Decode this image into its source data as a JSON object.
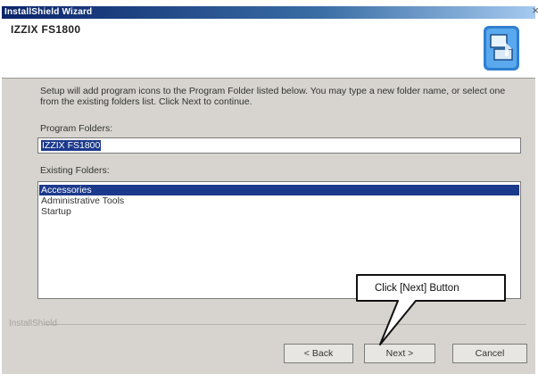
{
  "window": {
    "title": "InstallShield Wizard",
    "close_glyph": "×"
  },
  "header": {
    "product": "IZZIX FS1800",
    "logo_icon": "installshield-computer-icon"
  },
  "instructions": "Setup will add program icons to the Program Folder listed below. You may type a new folder name, or select one from the existing folders list. Click Next to continue.",
  "program_folder": {
    "label": "Program Folders:",
    "value": "IZZIX FS1800"
  },
  "existing_folders": {
    "label": "Existing Folders:",
    "items": [
      "Accessories",
      "Administrative Tools",
      "Startup"
    ],
    "selected_index": 0
  },
  "footer": {
    "brand": "InstallShield"
  },
  "buttons": {
    "back": "< Back",
    "next": "Next >",
    "cancel": "Cancel"
  },
  "annotation": {
    "text": "Click [Next] Button"
  },
  "colors": {
    "titlebar": "#0a246a",
    "selection": "#1c3a8c",
    "dialog_bg": "#d7d4cf"
  }
}
